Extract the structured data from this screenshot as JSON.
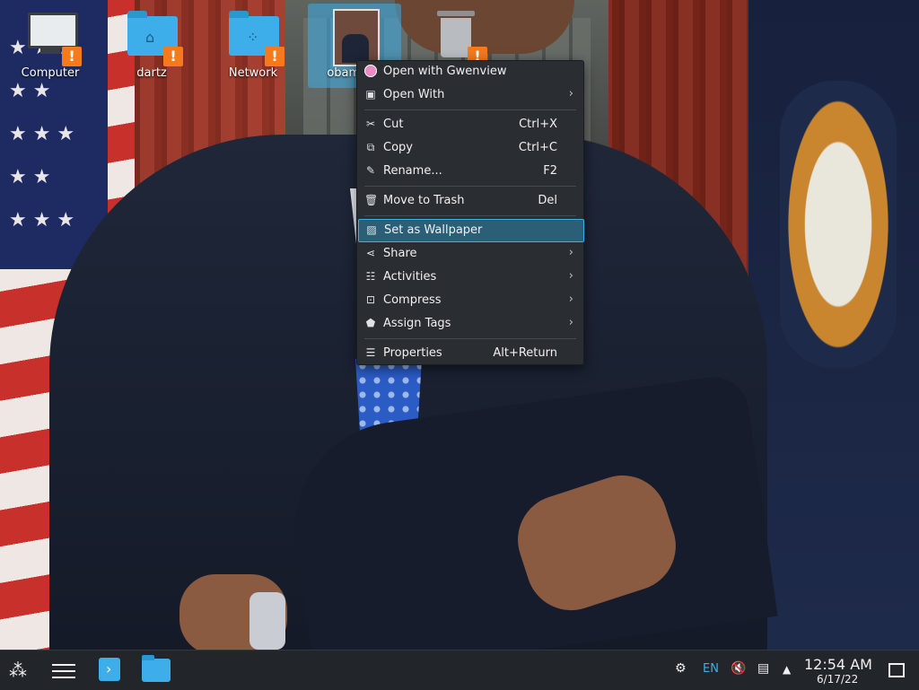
{
  "desktop_icons": [
    {
      "label": "Computer"
    },
    {
      "label": "dartz"
    },
    {
      "label": "Network"
    },
    {
      "label": "obamium"
    },
    {
      "label": ""
    }
  ],
  "context_menu": {
    "items": [
      {
        "label": "Open with Gwenview",
        "shortcut": "",
        "submenu": false,
        "icon": "gwenview-icon"
      },
      {
        "label": "Open With",
        "shortcut": "",
        "submenu": true,
        "icon": "open-with-icon"
      },
      {
        "label": "Cut",
        "shortcut": "Ctrl+X",
        "submenu": false,
        "icon": "cut-icon"
      },
      {
        "label": "Copy",
        "shortcut": "Ctrl+C",
        "submenu": false,
        "icon": "copy-icon"
      },
      {
        "label": "Rename...",
        "shortcut": "F2",
        "submenu": false,
        "icon": "rename-icon"
      },
      {
        "label": "Move to Trash",
        "shortcut": "Del",
        "submenu": false,
        "icon": "trash-icon"
      },
      {
        "label": "Set as Wallpaper",
        "shortcut": "",
        "submenu": false,
        "icon": "wallpaper-icon",
        "highlighted": true
      },
      {
        "label": "Share",
        "shortcut": "",
        "submenu": true,
        "icon": "share-icon"
      },
      {
        "label": "Activities",
        "shortcut": "",
        "submenu": true,
        "icon": "activities-icon"
      },
      {
        "label": "Compress",
        "shortcut": "",
        "submenu": true,
        "icon": "compress-icon"
      },
      {
        "label": "Assign Tags",
        "shortcut": "",
        "submenu": true,
        "icon": "tag-icon"
      },
      {
        "label": "Properties",
        "shortcut": "Alt+Return",
        "submenu": false,
        "icon": "properties-icon"
      }
    ]
  },
  "taskbar": {
    "keyboard_layout": "EN",
    "clock_time": "12:54 AM",
    "clock_date": "6/17/22"
  },
  "colors": {
    "accent": "#3daee9",
    "menu_bg": "#2a2e32",
    "highlight_bg": "#2b5f78",
    "warning": "#f47a1c",
    "taskbar_bg": "#22262a"
  }
}
